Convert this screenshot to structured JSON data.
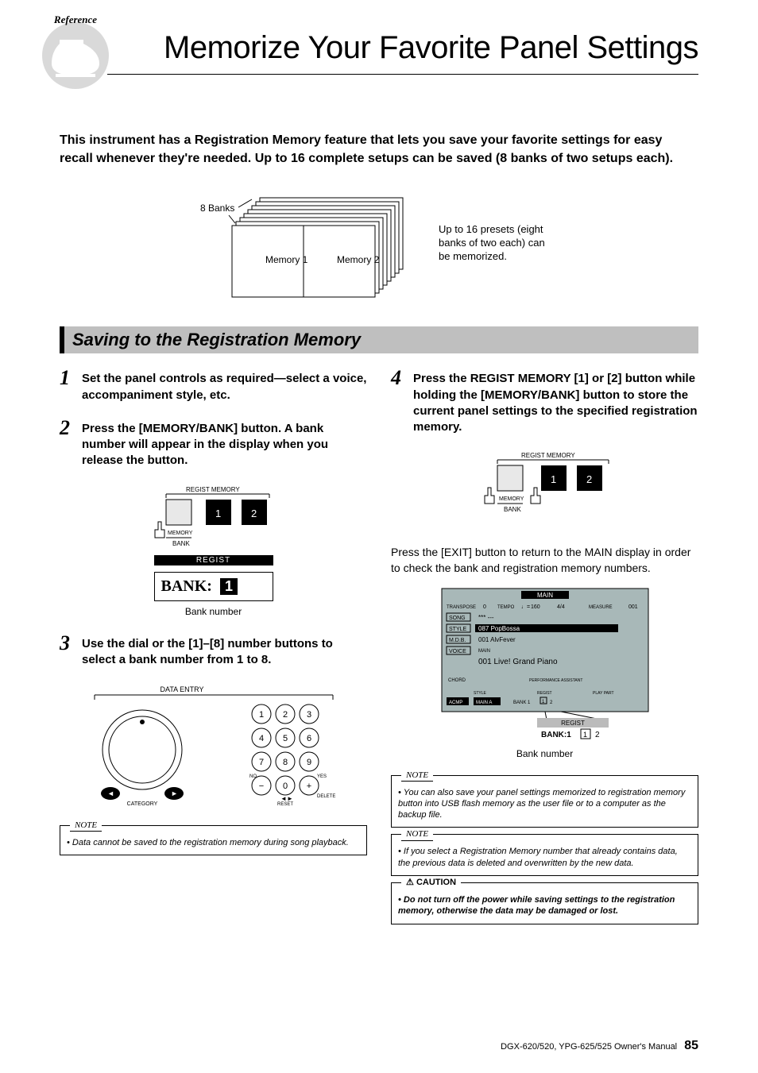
{
  "header": {
    "reference_tag": "Reference",
    "title": "Memorize Your Favorite Panel Settings"
  },
  "intro": "This instrument has a Registration Memory feature that lets you save your favorite settings for easy recall whenever they're needed. Up to 16 complete setups can be saved (8 banks of two setups each).",
  "banks_diagram": {
    "label_banks": "8 Banks",
    "mem1": "Memory 1",
    "mem2": "Memory 2",
    "caption": "Up to 16 presets (eight banks of two each) can be memorized."
  },
  "section_title": "Saving to the Registration Memory",
  "steps": {
    "s1_num": "1",
    "s1_text": "Set the panel controls as required—select a voice, accompaniment style, etc.",
    "s2_num": "2",
    "s2_text": "Press the [MEMORY/BANK] button. A bank number will appear in the display when you release the button.",
    "s3_num": "3",
    "s3_text": "Use the dial or the [1]–[8] number buttons to select a bank number from 1 to 8.",
    "s4_num": "4",
    "s4_text": "Press the REGIST MEMORY [1] or [2] button while holding the [MEMORY/BANK] button to store the current panel settings to the specified registration memory."
  },
  "regist_panel": {
    "header": "REGIST MEMORY",
    "btn1": "1",
    "btn2": "2",
    "memory": "MEMORY",
    "bank": "BANK"
  },
  "bank_display": {
    "bar": "REGIST",
    "label": "BANK:",
    "value": "1",
    "caption": "Bank number"
  },
  "data_entry": {
    "label": "DATA ENTRY",
    "category": "CATEGORY",
    "reset": "RESET",
    "no": "NO",
    "yes": "YES",
    "delete": "DELETE"
  },
  "notes": {
    "note1_label": "NOTE",
    "note1_text": "Data cannot be saved to the registration memory during song playback.",
    "note2_label": "NOTE",
    "note2_text": "You can also save your panel settings memorized to registration memory button into USB flash memory as the user file or to a computer as the backup file.",
    "note3_label": "NOTE",
    "note3_text": "If you select a Registration Memory number that already contains data, the previous data is deleted and overwritten by the new data."
  },
  "caution": {
    "label": "CAUTION",
    "icon": "⚠",
    "text": "Do not turn off the power while saving settings to the registration memory, otherwise the data may be damaged or lost."
  },
  "exit_text": "Press the [EXIT] button to return to the MAIN display in order to check the bank and registration memory numbers.",
  "main_display": {
    "title": "MAIN",
    "transpose_l": "TRANSPOSE",
    "transpose_v": "0",
    "tempo_l": "TEMPO",
    "tempo_v": "160",
    "sig": "4/4",
    "measure_l": "MEASURE",
    "measure_v": "001",
    "song_l": "SONG",
    "song_v": "*** ---",
    "style_l": "STYLE",
    "style_v": "087 PopBossa",
    "mdb_l": "M.D.B.",
    "mdb_v": "001 AlvFever",
    "voice_l": "VOICE",
    "voice_sub": "MAIN",
    "voice_v": "001 Live! Grand Piano",
    "chord": "CHORD",
    "pa": "PERFORMANCE ASSISTANT",
    "style_sec": "STYLE",
    "regist_sec": "REGIST",
    "play_sec": "PLAY PART",
    "acmp": "ACMP",
    "main_a": "MAIN A",
    "bank": "BANK 1",
    "regist_bar": "REGIST",
    "regist_bank": "BANK:1",
    "regist_12": "1  2",
    "caption": "Bank number"
  },
  "footer": {
    "text": "DGX-620/520, YPG-625/525  Owner's Manual",
    "page": "85"
  }
}
